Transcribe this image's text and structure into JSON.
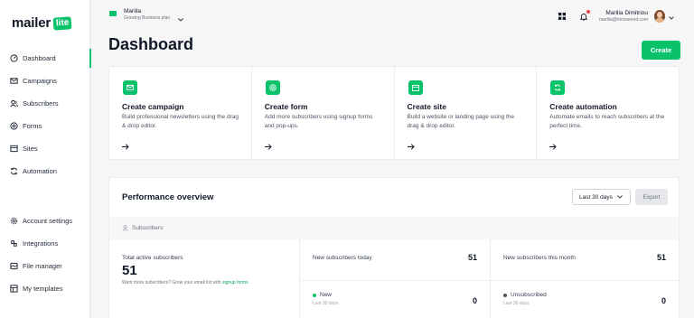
{
  "brand": {
    "logo_text": "mailer",
    "logo_badge": "lite",
    "accent": "#09c269"
  },
  "account": {
    "name": "Marilia",
    "plan": "Growing Business plan"
  },
  "user": {
    "name": "Marilia Dimitriou",
    "email": "marilia@mooseend.com"
  },
  "sidebar": {
    "items": [
      {
        "label": "Dashboard",
        "icon": "dashboard-icon",
        "active": true
      },
      {
        "label": "Campaigns",
        "icon": "envelope-icon"
      },
      {
        "label": "Subscribers",
        "icon": "users-icon"
      },
      {
        "label": "Forms",
        "icon": "forms-icon"
      },
      {
        "label": "Sites",
        "icon": "sites-icon"
      },
      {
        "label": "Automation",
        "icon": "automation-icon"
      },
      {
        "label": "Account settings",
        "icon": "gear-icon"
      },
      {
        "label": "Integrations",
        "icon": "integrations-icon"
      },
      {
        "label": "File manager",
        "icon": "file-icon"
      },
      {
        "label": "My templates",
        "icon": "templates-icon"
      }
    ]
  },
  "main": {
    "title": "Dashboard",
    "create_label": "Create",
    "cards": [
      {
        "title": "Create campaign",
        "desc": "Build professional newsletters using the drag & drop editor.",
        "icon": "envelope-icon"
      },
      {
        "title": "Create form",
        "desc": "Add more subscribers using signup forms and pop-ups.",
        "icon": "target-icon"
      },
      {
        "title": "Create site",
        "desc": "Build a website or landing page using the drag & drop editor.",
        "icon": "browser-icon"
      },
      {
        "title": "Create automation",
        "desc": "Automate emails to reach subscribers at the perfect time.",
        "icon": "refresh-icon"
      }
    ]
  },
  "performance": {
    "title": "Performance overview",
    "range": "Last 30 days",
    "export_label": "Export",
    "section_label": "Subscribers",
    "total_label": "Total active subscribers",
    "total_value": "51",
    "total_note_prefix": "Want more subscribers? Grow your email list with",
    "total_note_link": "signup forms",
    "today_label": "New subscribers today",
    "today_value": "51",
    "month_label": "New subscribers this month",
    "month_value": "51",
    "new_label": "New",
    "new_sub": "Last 30 days",
    "new_value": "0",
    "new_color": "#09c269",
    "unsub_label": "Unsubscribed",
    "unsub_sub": "Last 30 days",
    "unsub_value": "0",
    "unsub_color": "#4b5563"
  }
}
